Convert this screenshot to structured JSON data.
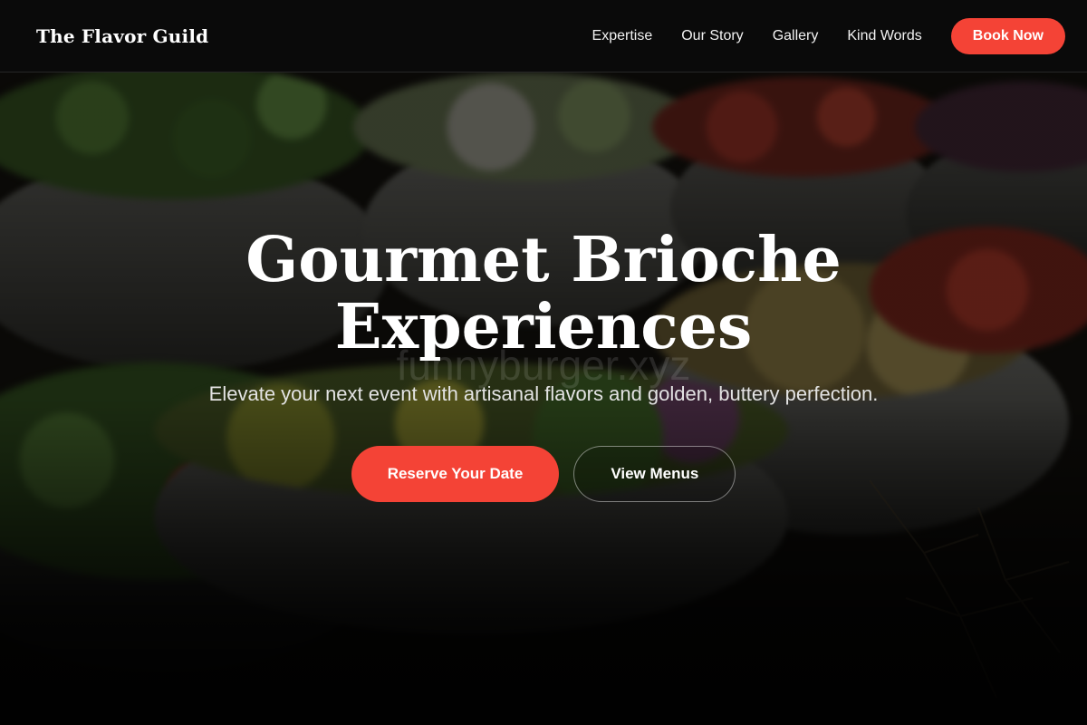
{
  "nav": {
    "brand": "The Flavor Guild",
    "links": [
      "Expertise",
      "Our Story",
      "Gallery",
      "Kind Words"
    ],
    "cta_label": "Book Now"
  },
  "hero": {
    "title_line1": "Gourmet Brioche",
    "title_line2": "Experiences",
    "subtitle": "Elevate your next event with artisanal flavors and golden, buttery perfection.",
    "primary_cta": "Reserve Your Date",
    "secondary_cta": "View Menus",
    "watermark": "funnyburger.xyz",
    "background_image": "bowls-of-fresh-salads-photo"
  },
  "colors": {
    "accent": "#f44336",
    "navbar_bg": "#0a0a0a",
    "text": "#ffffff"
  }
}
